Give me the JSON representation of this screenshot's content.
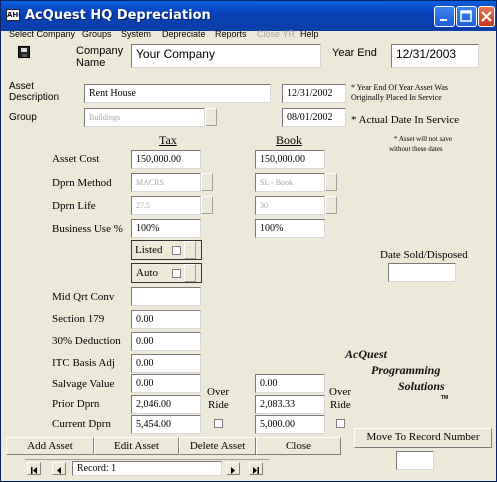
{
  "window": {
    "title": "AcQuest HQ Depreciation",
    "icon_text": "AHQ",
    "controls": {
      "minimize": "–",
      "maximize": "□",
      "close": "✕"
    }
  },
  "menu": [
    "Select Company",
    "Groups",
    "System",
    "Depreciate",
    "Reports",
    "Close YR",
    "Help"
  ],
  "header": {
    "save_icon": "floppy-disk-icon",
    "company_label_1": "Company",
    "company_label_2": "Name",
    "company_value": "Your Company",
    "year_end_label": "Year End",
    "year_end_value": "12/31/2003"
  },
  "asset": {
    "description_label_1": "Asset",
    "description_label_2": "Description",
    "description_value": "Rent House",
    "group_label": "Group",
    "group_value": "Buildings",
    "year_end_date": "12/31/2002",
    "year_end_note_1": "* Year End Of Year Asset Was",
    "year_end_note_2": "Originally Placed In Service",
    "actual_date": "08/01/2002",
    "actual_date_label": "* Actual Date In Service",
    "save_note_1": "* Asset will not save",
    "save_note_2": "without these dates"
  },
  "columns": {
    "tax": "Tax",
    "book": "Book"
  },
  "rows": {
    "asset_cost": {
      "label": "Asset Cost",
      "tax": "150,000.00",
      "book": "150,000.00"
    },
    "dprn_method": {
      "label": "Dprn Method",
      "tax": "MACRS",
      "book": "SL - Book"
    },
    "dprn_life": {
      "label": "Dprn Life",
      "tax": "27.5",
      "book": "30"
    },
    "business_use": {
      "label": "Business Use %",
      "tax": "100%",
      "book": "100%"
    },
    "listed": {
      "label": "Listed"
    },
    "auto": {
      "label": "Auto"
    },
    "mid_qrt": {
      "label": "Mid Qrt Conv",
      "tax": ""
    },
    "section_179": {
      "label": "Section 179",
      "tax": "0.00"
    },
    "deduction_30": {
      "label": "30% Deduction",
      "tax": "0.00"
    },
    "itc_basis": {
      "label": "ITC Basis Adj",
      "tax": "0.00"
    },
    "salvage": {
      "label": "Salvage Value",
      "tax": "0.00",
      "book": "0.00"
    },
    "prior_dprn": {
      "label": "Prior Dprn",
      "tax": "2,046.00",
      "book": "2,083.33"
    },
    "current_dprn": {
      "label": "Current Dprn",
      "tax": "5,454.00",
      "book": "5,000.00"
    }
  },
  "override": {
    "line1": "Over",
    "line2": "Ride"
  },
  "sold": {
    "label": "Date Sold/Disposed",
    "value": ""
  },
  "logo": {
    "line1": "AcQuest",
    "line2": "Programming",
    "line3": "Solutions",
    "tm": "TM"
  },
  "buttons": {
    "add": "Add Asset",
    "edit": "Edit Asset",
    "delete": "Delete Asset",
    "close": "Close",
    "move": "Move To Record Number",
    "move_value": ""
  },
  "nav": {
    "record": "Record: 1"
  }
}
